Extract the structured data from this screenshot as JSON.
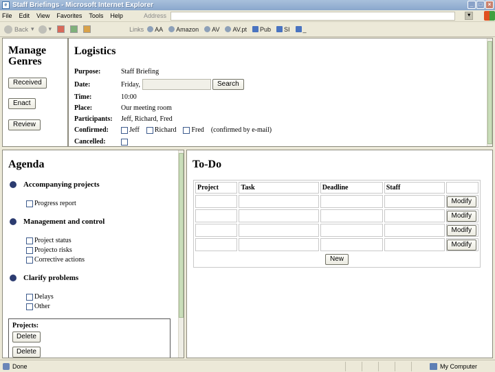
{
  "window": {
    "title": "Staff Briefings - Microsoft Internet Explorer"
  },
  "menu": [
    "File",
    "Edit",
    "View",
    "Favorites",
    "Tools",
    "Help"
  ],
  "address": {
    "label": "Address",
    "value": ""
  },
  "toolbar": {
    "back_label": "Back",
    "links_label": "Links",
    "links": [
      "AA",
      "Amazon",
      "AV",
      "AV.pt",
      "Pub",
      "SI",
      "_"
    ]
  },
  "genres": {
    "title": "Manage Genres",
    "buttons": [
      "Received",
      "Enact",
      "Review"
    ]
  },
  "logistics": {
    "title": "Logistics",
    "purpose_label": "Purpose:",
    "purpose_value": "Staff Briefing",
    "date_label": "Date:",
    "date_value": "Friday,",
    "search_label": "Search",
    "time_label": "Time:",
    "time_value": "10:00",
    "place_label": "Place:",
    "place_value": "Our meeting room",
    "participants_label": "Participants:",
    "participants_value": "Jeff, Richard, Fred",
    "confirmed_label": "Confirmed:",
    "confirmed_people": [
      "Jeff",
      "Richard",
      "Fred"
    ],
    "confirmed_note": "(confirmed by e-mail)",
    "cancelled_label": "Cancelled:"
  },
  "agenda": {
    "title": "Agenda",
    "sections": [
      {
        "name": "Accompanying projects",
        "items": [
          "Progress report"
        ]
      },
      {
        "name": "Management and control",
        "items": [
          "Project status",
          "Projecto risks",
          "Corrective actions"
        ]
      },
      {
        "name": "Clarify problems",
        "items": [
          "Delays",
          "Other"
        ]
      }
    ],
    "projects_label": "Projects:",
    "delete_label": "Delete"
  },
  "todo": {
    "title": "To-Do",
    "columns": [
      "Project",
      "Task",
      "Deadline",
      "Staff"
    ],
    "modify_label": "Modify",
    "new_label": "New"
  },
  "status": {
    "text": "Done",
    "zone": "My Computer"
  }
}
